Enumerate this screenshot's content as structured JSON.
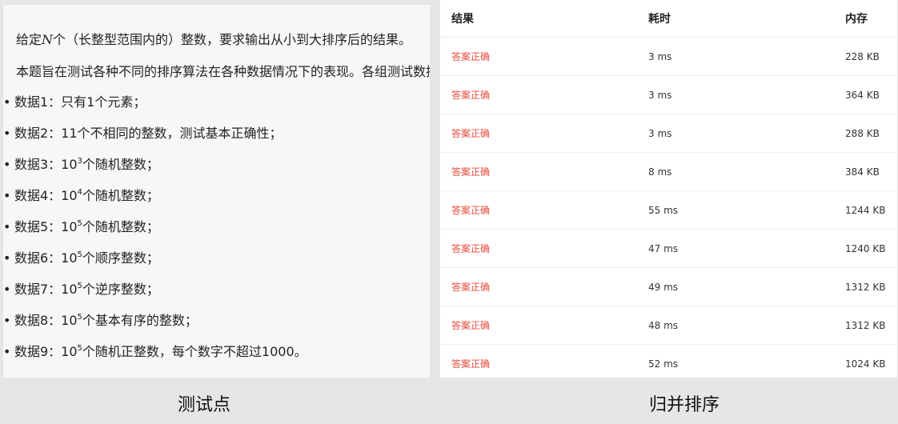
{
  "problem": {
    "intro_prefix": "给定",
    "intro_var": "N",
    "intro_suffix": "个（长整型范围内的）整数，要求输出从小到大排序后的结果。",
    "desc": "本题旨在测试各种不同的排序算法在各种数据情况下的表现。各组测试数据",
    "items": [
      {
        "label": "数据1：只有1个元素；"
      },
      {
        "label": "数据2：11个不相同的整数，测试基本正确性；"
      },
      {
        "pre": "数据3：10",
        "exp": "3",
        "post": "个随机整数；"
      },
      {
        "pre": "数据4：10",
        "exp": "4",
        "post": "个随机整数；"
      },
      {
        "pre": "数据5：10",
        "exp": "5",
        "post": "个随机整数；"
      },
      {
        "pre": "数据6：10",
        "exp": "5",
        "post": "个顺序整数；"
      },
      {
        "pre": "数据7：10",
        "exp": "5",
        "post": "个逆序整数；"
      },
      {
        "pre": "数据8：10",
        "exp": "5",
        "post": "个基本有序的整数；"
      },
      {
        "pre": "数据9：10",
        "exp": "5",
        "post": "个随机正整数，每个数字不超过1000。"
      }
    ]
  },
  "results": {
    "headers": {
      "status": "结果",
      "time": "耗时",
      "memory": "内存"
    },
    "rows": [
      {
        "status": "答案正确",
        "time": "3 ms",
        "memory": "228 KB"
      },
      {
        "status": "答案正确",
        "time": "3 ms",
        "memory": "364 KB"
      },
      {
        "status": "答案正确",
        "time": "3 ms",
        "memory": "288 KB"
      },
      {
        "status": "答案正确",
        "time": "8 ms",
        "memory": "384 KB"
      },
      {
        "status": "答案正确",
        "time": "55 ms",
        "memory": "1244 KB"
      },
      {
        "status": "答案正确",
        "time": "47 ms",
        "memory": "1240 KB"
      },
      {
        "status": "答案正确",
        "time": "49 ms",
        "memory": "1312 KB"
      },
      {
        "status": "答案正确",
        "time": "48 ms",
        "memory": "1312 KB"
      },
      {
        "status": "答案正确",
        "time": "52 ms",
        "memory": "1024 KB"
      }
    ]
  },
  "captions": {
    "left": "测试点",
    "right": "归并排序"
  },
  "colors": {
    "status_ok": "#e74c3c"
  }
}
